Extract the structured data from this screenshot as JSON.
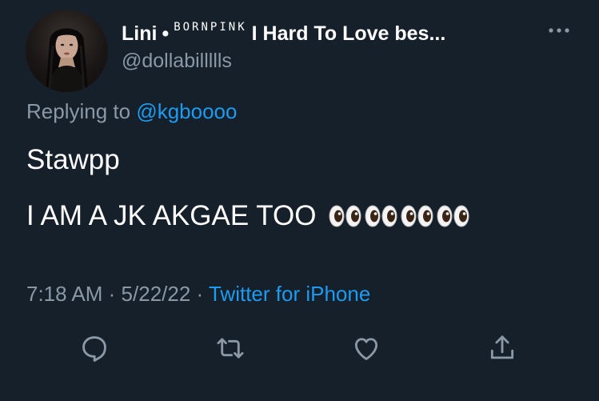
{
  "author": {
    "display_name": "Lini",
    "separator": "•",
    "tag": "BORNPINK",
    "name_suffix": "I Hard To Love bes...",
    "handle": "@dollabillllls"
  },
  "reply": {
    "prefix": "Replying to",
    "mention": "@kgboooo"
  },
  "body": {
    "line1": "Stawpp",
    "line2": "I AM A JK AKGAE TOO",
    "emoji_count": 4,
    "emoji": "eyes"
  },
  "meta": {
    "time": "7:18 AM",
    "sep1": "·",
    "date": "5/22/22",
    "sep2": "·",
    "source": "Twitter for iPhone"
  },
  "icons": {
    "more": "more-horizontal-icon",
    "reply": "reply-icon",
    "retweet": "retweet-icon",
    "like": "heart-icon",
    "share": "share-icon"
  },
  "colors": {
    "background": "#15202b",
    "text": "#ffffff",
    "secondary": "#8b98a5",
    "accent": "#1d9bf0"
  }
}
